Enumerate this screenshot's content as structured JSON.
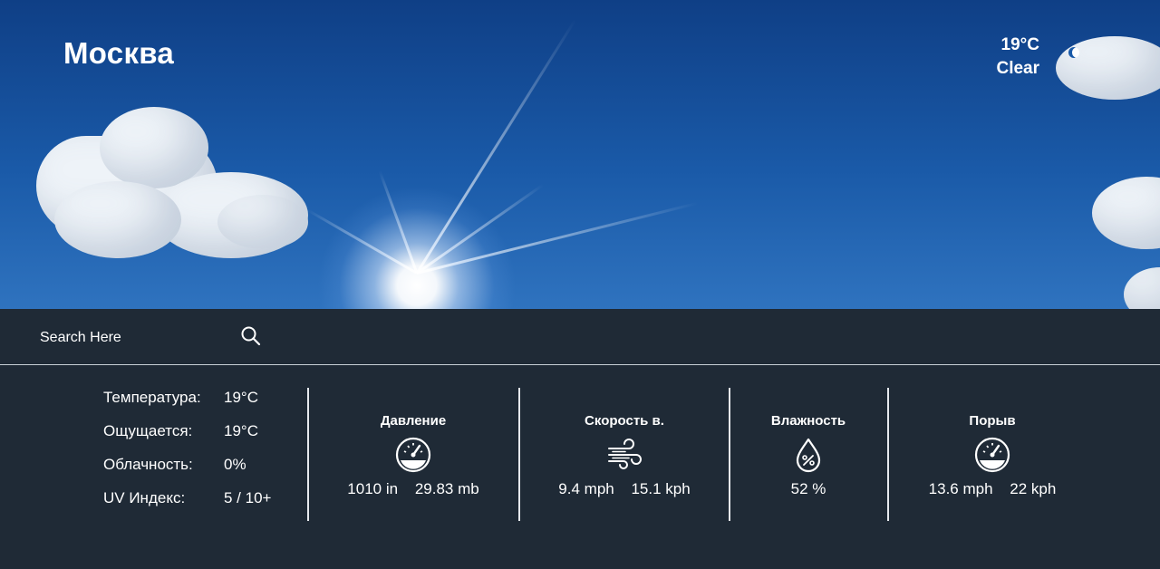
{
  "header": {
    "city": "Москва",
    "temp": "19°C",
    "condition": "Clear"
  },
  "search": {
    "placeholder": "Search Here"
  },
  "stats": [
    {
      "label": "Температура:",
      "value": "19°C"
    },
    {
      "label": "Ощущается:",
      "value": "19°C"
    },
    {
      "label": "Облачность:",
      "value": "0%"
    },
    {
      "label": "UV Индекс:",
      "value": "5 / 10+"
    }
  ],
  "cards": {
    "pressure": {
      "title": "Давление",
      "value1": "1010 in",
      "value2": "29.83 mb",
      "icon": "gauge-icon"
    },
    "wind": {
      "title": "Скорость в.",
      "value1": "9.4 mph",
      "value2": "15.1 kph",
      "icon": "wind-icon"
    },
    "humidity": {
      "title": "Влажность",
      "value1": "52 %",
      "icon": "humidity-drop-icon"
    },
    "gust": {
      "title": "Порыв",
      "value1": "13.6 mph",
      "value2": "22 kph",
      "icon": "gauge-icon"
    }
  },
  "colors": {
    "panel": "#1f2a36",
    "sky": "#1a5aa8",
    "text": "#ffffff"
  }
}
